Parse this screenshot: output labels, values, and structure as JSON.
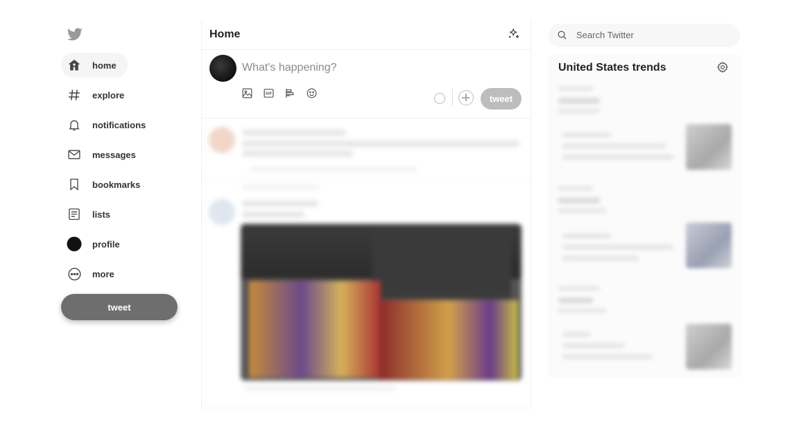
{
  "sidebar": {
    "items": [
      {
        "label": "home",
        "icon": "home-icon"
      },
      {
        "label": "explore",
        "icon": "hash-icon"
      },
      {
        "label": "notifications",
        "icon": "bell-icon"
      },
      {
        "label": "messages",
        "icon": "mail-icon"
      },
      {
        "label": "bookmarks",
        "icon": "bookmark-icon"
      },
      {
        "label": "lists",
        "icon": "list-icon"
      },
      {
        "label": "profile",
        "icon": "avatar-icon"
      },
      {
        "label": "more",
        "icon": "more-icon"
      }
    ],
    "tweet_label": "tweet"
  },
  "main": {
    "title": "Home",
    "composer": {
      "placeholder": "What's happening?",
      "tweet_label": "tweet"
    }
  },
  "search": {
    "placeholder": "Search Twitter"
  },
  "trends": {
    "title": "United States trends"
  },
  "colors": {
    "tweet_button": "#6e6e6e",
    "composer_button": "#bdbdbd",
    "icon": "#444444"
  }
}
